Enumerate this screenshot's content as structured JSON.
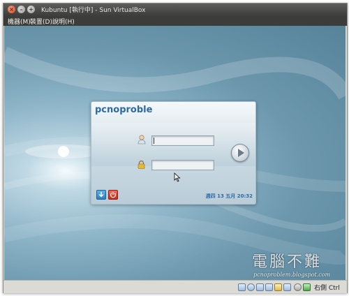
{
  "window": {
    "title": "Kubuntu [執行中] - Sun VirtualBox"
  },
  "menubar": {
    "items": [
      "機器(M)",
      "裝置(D)",
      "說明(H)"
    ]
  },
  "login": {
    "hostname": "pcnoproblem",
    "username_value": "",
    "password_value": "",
    "clock": "週四 13 五月 20:32"
  },
  "watermark": {
    "title": "電腦不難",
    "url": "pcnoproblem.blogspot.com"
  },
  "statusbar": {
    "host_key": "右側 Ctrl",
    "icons": [
      "hard-disk-icon",
      "cd-icon",
      "network-icon",
      "usb-icon",
      "shared-folder-icon",
      "display-icon",
      "seamless-icon",
      "mouse-integration-icon",
      "host-key-icon"
    ]
  }
}
